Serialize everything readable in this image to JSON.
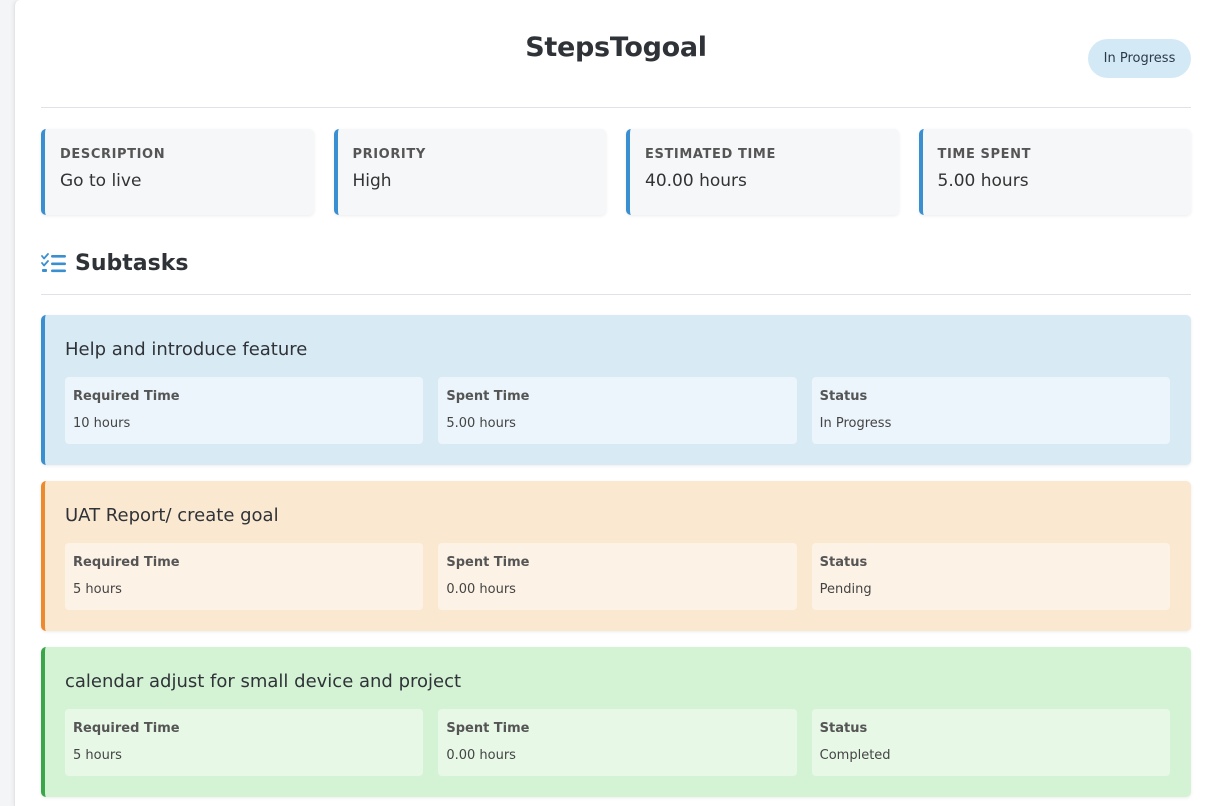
{
  "header": {
    "title": "StepsTogoal",
    "status_badge": "In Progress"
  },
  "info": [
    {
      "label": "DESCRIPTION",
      "value": "Go to live"
    },
    {
      "label": "PRIORITY",
      "value": "High"
    },
    {
      "label": "ESTIMATED TIME",
      "value": "40.00 hours"
    },
    {
      "label": "TIME SPENT",
      "value": "5.00 hours"
    }
  ],
  "section": {
    "title": "Subtasks",
    "icon": "checklist-icon"
  },
  "subtasks": [
    {
      "title": "Help and introduce feature",
      "required_label": "Required Time",
      "required_value": "10 hours",
      "spent_label": "Spent Time",
      "spent_value": "5.00 hours",
      "status_label": "Status",
      "status_value": "In Progress",
      "accent": "#3a8fd0"
    },
    {
      "title": "UAT Report/ create goal",
      "required_label": "Required Time",
      "required_value": "5 hours",
      "spent_label": "Spent Time",
      "spent_value": "0.00 hours",
      "status_label": "Status",
      "status_value": "Pending",
      "accent": "#ee8a2e"
    },
    {
      "title": "calendar adjust for small device and project",
      "required_label": "Required Time",
      "required_value": "5 hours",
      "spent_label": "Spent Time",
      "spent_value": "0.00 hours",
      "status_label": "Status",
      "status_value": "Completed",
      "accent": "#3aa64a"
    }
  ],
  "colors": {
    "badge_bg": "#d4e9f6",
    "info_accent": "#3a8fd0",
    "in_progress_bg": "#d8eaf4",
    "pending_bg": "#fbe8d1",
    "completed_bg": "#d4f3d5"
  }
}
